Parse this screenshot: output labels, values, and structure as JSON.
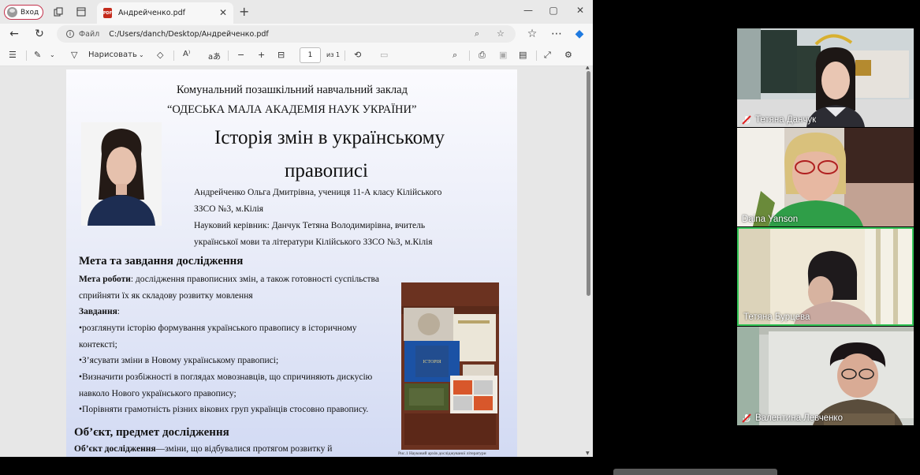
{
  "browser": {
    "profile_label": "Вход",
    "tab_title": "Андрейченко.pdf",
    "address_prefix": "Файл",
    "address": "C:/Users/danch/Desktop/Андрейченко.pdf"
  },
  "pdf_toolbar": {
    "draw_label": "Нарисовать",
    "page_current": "1",
    "page_total": "из 1"
  },
  "document": {
    "institution_line1": "Комунальний позашкільний навчальний заклад",
    "institution_line2": "“ОДЕСЬКА МАЛА АКАДЕМІЯ НАУК УКРАЇНИ”",
    "title_line1": "Історія змін в українському",
    "title_line2": "правописі",
    "author_line1": "Андрейченко Ольга Дмитрівна, учениця 11-А класу Кілійського",
    "author_line2": "ЗЗСО №3, м.Кілія",
    "advisor_line1": "Науковий керівник: Данчук Тетяна Володимирівна, вчитель",
    "advisor_line2": "української мови та літератури Кілійського ЗЗСО №3, м.Кілія",
    "section1_heading": "Мета та завдання дослідження",
    "goal_label": "Мета роботи",
    "goal_text_line1": ": дослідження правописних змін, а також готовності суспільства",
    "goal_text_line2": "сприйняти їх як складову розвитку мовлення",
    "tasks_label": "Завдання",
    "tasks_colon": ":",
    "task1_line1": "•розглянути історію формування українського правопису в історичному",
    "task1_line2": "контексті;",
    "task2": "•З’ясувати зміни в Новому українському правописі;",
    "task3_line1": "•Визначити розбіжності в поглядах мовознавців, що спричиняють дискусію",
    "task3_line2": "навколо Нового українського правопису;",
    "task4": "•Порівняти грамотність різних вікових груп українців стосовно правопису.",
    "section2_heading": "Об’єкт, предмет дослідження",
    "object_label": "Об’єкт дослідження",
    "object_text": "—зміни, що відбувалися протягом розвитку й",
    "figure_caption": "Рис.1 Науковий архів досліджуваної літератури"
  },
  "participants": [
    {
      "name": "Тетяна Данчук",
      "muted": true
    },
    {
      "name": "Daina Yanson",
      "muted": false
    },
    {
      "name": "Тетяна Бурцева",
      "muted": false,
      "active_speaker": true
    },
    {
      "name": "Валентина Левченко",
      "muted": true
    }
  ],
  "colors": {
    "active_speaker_border": "#34c759",
    "muted_icon": "#e02020",
    "profile_border": "#c4314b"
  }
}
